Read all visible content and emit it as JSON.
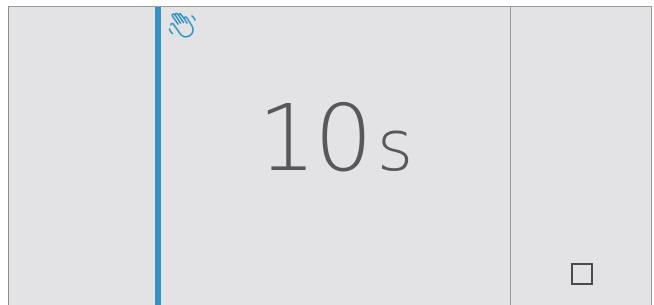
{
  "icons": {
    "hand": "waving-hand-icon",
    "stop": "stop-square-icon"
  },
  "colors": {
    "accent": "#3393c4",
    "background": "#e3e3e5",
    "text": "#58585a"
  },
  "timer": {
    "value": "10",
    "unit": "s"
  }
}
